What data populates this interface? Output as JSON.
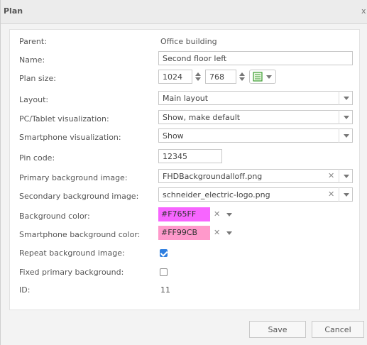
{
  "window": {
    "title": "Plan",
    "close_glyph": "x"
  },
  "form": {
    "parent": {
      "label": "Parent:",
      "value": "Office building"
    },
    "name": {
      "label": "Name:",
      "value": "Second floor left"
    },
    "plan_size": {
      "label": "Plan size:",
      "width": "1024",
      "height": "768",
      "icon": "layout-grid-icon"
    },
    "layout": {
      "label": "Layout:",
      "value": "Main layout"
    },
    "pc_tablet": {
      "label": "PC/Tablet visualization:",
      "value": "Show, make default"
    },
    "smartphone_vis": {
      "label": "Smartphone visualization:",
      "value": "Show"
    },
    "pin_code": {
      "label": "Pin code:",
      "value": "12345"
    },
    "primary_bg": {
      "label": "Primary background image:",
      "value": "FHDBackgroundalloff.png"
    },
    "secondary_bg": {
      "label": "Secondary background image:",
      "value": "schneider_electric-logo.png"
    },
    "bg_color": {
      "label": "Background color:",
      "value": "#F765FF",
      "swatch": "#F765FF"
    },
    "smartphone_bg_color": {
      "label": "Smartphone background color:",
      "value": "#FF99CB",
      "swatch": "#FF99CB"
    },
    "repeat_bg": {
      "label": "Repeat background image:",
      "checked": true
    },
    "fixed_bg": {
      "label": "Fixed primary background:",
      "checked": false
    },
    "id": {
      "label": "ID:",
      "value": "11"
    }
  },
  "buttons": {
    "save": "Save",
    "cancel": "Cancel"
  },
  "colors": {
    "checkbox_on": "#2F7FE0"
  }
}
